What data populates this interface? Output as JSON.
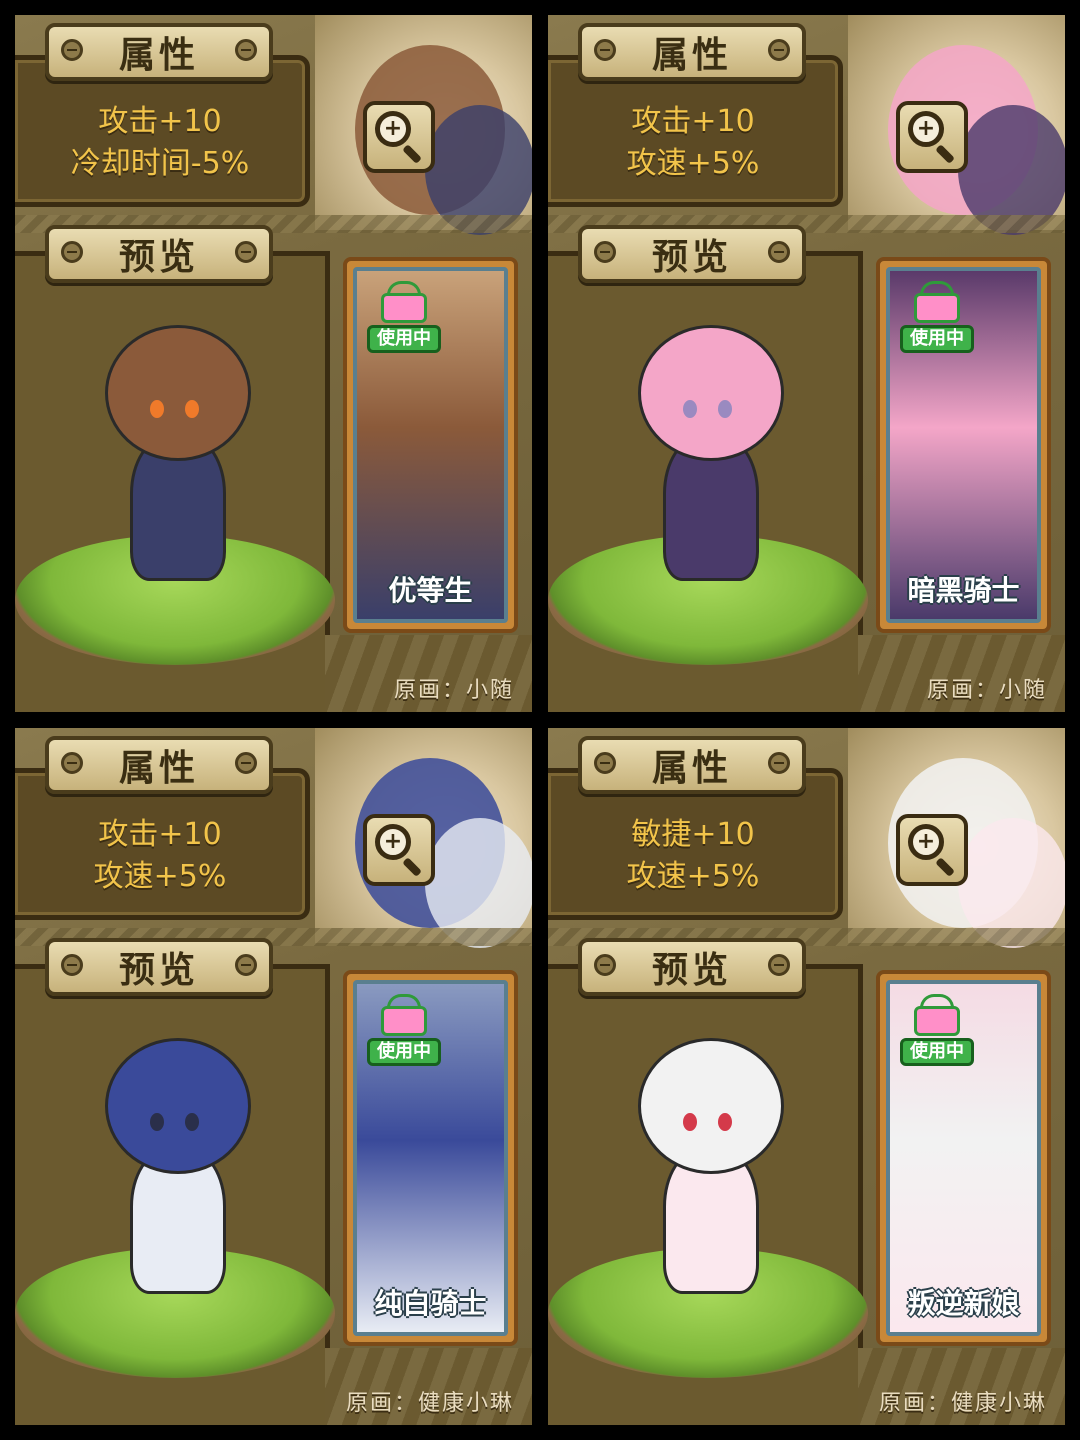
{
  "panels": [
    {
      "attr_header": "属性",
      "attr_lines": [
        "攻击+10",
        "冷却时间-5%"
      ],
      "preview_header": "预览",
      "skin_badge": "使用中",
      "skin_name": "优等生",
      "artist": "原画：小随",
      "colors": {
        "hair": "#8b5a3a",
        "outfit": "#3a3f6a",
        "accent": "#f07a2a",
        "card_bg": "#c9a27a"
      }
    },
    {
      "attr_header": "属性",
      "attr_lines": [
        "攻击+10",
        "攻速+5%"
      ],
      "preview_header": "预览",
      "skin_badge": "使用中",
      "skin_name": "暗黑骑士",
      "artist": "原画：小随",
      "colors": {
        "hair": "#f4a6c8",
        "outfit": "#4a3a6a",
        "accent": "#9a8ac0",
        "card_bg": "#5a3a6a"
      }
    },
    {
      "attr_header": "属性",
      "attr_lines": [
        "攻击+10",
        "攻速+5%"
      ],
      "preview_header": "预览",
      "skin_badge": "使用中",
      "skin_name": "纯白骑士",
      "artist": "原画：健康小琳",
      "colors": {
        "hair": "#3a4a9a",
        "outfit": "#e8ecf4",
        "accent": "#2a2f4a",
        "card_bg": "#8a9ac0"
      }
    },
    {
      "attr_header": "属性",
      "attr_lines": [
        "敏捷+10",
        "攻速+5%"
      ],
      "preview_header": "预览",
      "skin_badge": "使用中",
      "skin_name": "叛逆新娘",
      "artist": "原画：健康小琳",
      "colors": {
        "hair": "#f2f2f2",
        "outfit": "#fbe8ee",
        "accent": "#d43a4a",
        "card_bg": "#f4dbe4"
      }
    }
  ],
  "icons": {
    "zoom": "zoom-in-icon",
    "badge": "hanger-shirt-icon"
  }
}
